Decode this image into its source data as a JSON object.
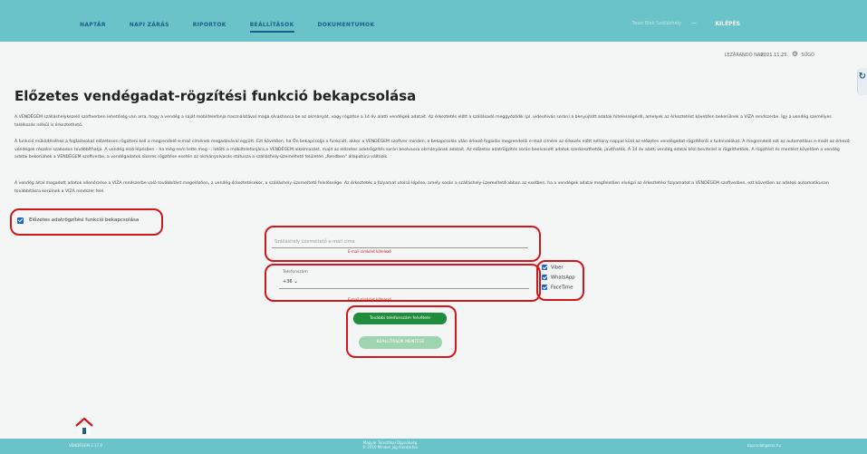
{
  "nav": {
    "items": [
      "NAPTÁR",
      "NAPI ZÁRÁS",
      "RIPORTOK",
      "BEÁLLÍTÁSOK",
      "DOKUMENTUMOK"
    ],
    "active_index": 3,
    "user": "Teszt Elek Szálláshely",
    "logout": "KILÉPÉS"
  },
  "status": {
    "lezarando_label": "LEZÁRANDÓ NAP:",
    "lezarando_date": "2021.11.25.",
    "setting_text": "SÚGÓ"
  },
  "page": {
    "title": "Előzetes vendégadat-rögzítési funkció bekapcsolása",
    "paragraphs": [
      "A VENDÉGEM szálláshelykezelő szoftverben lehetőség van arra, hogy a vendég a saját mobiltelefonja használatával maga olvashassa be az okmányát, vagy rögzítse a 14 év alatti vendégek adatait. Az érkeztetés előtt a szállásadó meggyőződik (pl. videohívás során) a benyújtott adatok hitelességéről, amelyek az érkeztetést követően bekerülnek a VIZA rendszerbe. Így a vendég személyes találkozás nélkül is érkeztethető.",
      "A funkció működéséhez a foglalásokat előzetesen rögzíteni kell a megrendelő e-mail címének megadásával együtt. Ezt követően, ha Ön bekapcsolja a funkciót, akkor a VENDÉGEM szoftver minden, a bekapcsolás után érkező foglalás megrendelői e-mail címére az érkezés előtt néhány nappal küld az előzetes vendégadat-rögzítésről a tudnivalókat. A megrendelő ezt az automatikus e-mailt az érkező vendégek részére szabadon továbbíthatja. A vendég első lépésben – ha még nem tette meg –, letölti a mobiltelefonjára a VENDÉGEM alkalmazást, majd az előzetes adatrögzítés során beolvassa okmányának adatait. Az előzetes adatrögzítés során beolvasott adatok szerkeszthetők, javíthatók. A 14 év alatti vendég adatai kézi beviteliel is rögzíthetőek. A rögzítést és mentést követően a vendég adatai bekerülnek a VENDÉGEM szoftverbe, a vendégadatok sikeres rögzítése esetén az okmányolvasás státusza a szálláshely-üzemeltető felületén „Rendben” állapotúra változik.",
      "A vendég által megadott adatok ellenőrzése a VIZA rendszerbe való továbbítást megelőzően, a vendég érkeztetésekor, a szálláshely-üzemeltető felelőssége. Az érkeztetés a folyamat utolsó lépése, amely során a szálláshely-üzemeltető abban az esetben, ha a vendégek adatai megfelelően elvégzi az érkeztetési folyamatot a VENDÉGEM szoftverben, ezt követően az adatok automatikusan továbbításra kerülnek a VIZA rendszer felé."
    ]
  },
  "form": {
    "enable_label": "Előzetes adatrögzítési funkció bekapcsolása",
    "email_placeholder": "Szálláshely üzemeltető e-mail címe",
    "email_error": "E-mail címként kötelező",
    "phone_label": "Telefonszám",
    "phone_prefix": "+36",
    "phone_error": "E-mail címként kötelező",
    "channels": [
      "Viber",
      "WhatsApp",
      "FaceTime"
    ],
    "add_phone_button": "További telefonszám felvétele",
    "save_button": "BEÁLLÍTÁSOK MENTÉSE"
  },
  "footer": {
    "left": "VENDÉGEM 2.17.0",
    "center_line1": "Magyar Turisztikai Ügynökség",
    "center_line2": "© 2019 Minden jog fenntartva",
    "right": "kapcsolat@nisz.hu"
  }
}
